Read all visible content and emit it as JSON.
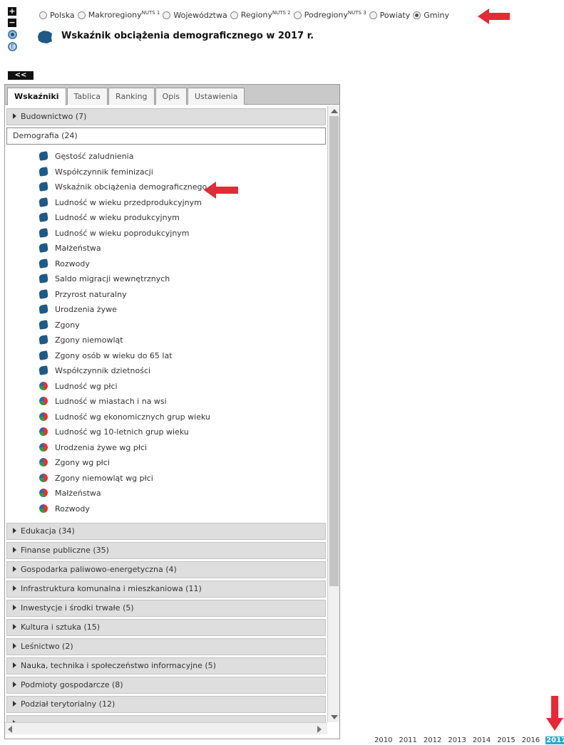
{
  "zoom": {
    "plus": "+",
    "minus": "−",
    "e_label": "E"
  },
  "levels": [
    {
      "label": "Polska",
      "sup": "",
      "selected": false
    },
    {
      "label": "Makroregiony",
      "sup": "NUTS 1",
      "selected": false
    },
    {
      "label": "Województwa",
      "sup": "",
      "selected": false
    },
    {
      "label": "Regiony",
      "sup": "NUTS 2",
      "selected": false
    },
    {
      "label": "Podregiony",
      "sup": "NUTS 3",
      "selected": false
    },
    {
      "label": "Powiaty",
      "sup": "",
      "selected": false
    },
    {
      "label": "Gminy",
      "sup": "",
      "selected": true
    }
  ],
  "page_title": "Wskaźnik obciążenia demograficznego w 2017 r.",
  "collapse_label": "<<",
  "tabs": [
    "Wskaźniki",
    "Tablica",
    "Ranking",
    "Opis",
    "Ustawienia"
  ],
  "active_tab": "Wskaźniki",
  "categories_before": [
    {
      "label": "Budownictwo (7)"
    }
  ],
  "open_category": {
    "label": "Demografia (24)",
    "items": [
      {
        "label": "Gęstość zaludnienia",
        "icon": "map"
      },
      {
        "label": "Współczynnik feminizacji",
        "icon": "map"
      },
      {
        "label": "Wskaźnik obciążenia demograficznego",
        "icon": "map"
      },
      {
        "label": "Ludność w wieku przedprodukcyjnym",
        "icon": "map"
      },
      {
        "label": "Ludność w wieku produkcyjnym",
        "icon": "map"
      },
      {
        "label": "Ludność w wieku poprodukcyjnym",
        "icon": "map"
      },
      {
        "label": "Małżeństwa",
        "icon": "map"
      },
      {
        "label": "Rozwody",
        "icon": "map"
      },
      {
        "label": "Saldo migracji wewnętrznych",
        "icon": "map"
      },
      {
        "label": "Przyrost naturalny",
        "icon": "map"
      },
      {
        "label": "Urodzenia żywe",
        "icon": "map"
      },
      {
        "label": "Zgony",
        "icon": "map"
      },
      {
        "label": "Zgony niemowląt",
        "icon": "map"
      },
      {
        "label": "Zgony osób w wieku do 65 lat",
        "icon": "map"
      },
      {
        "label": "Współczynnik dzietności",
        "icon": "map"
      },
      {
        "label": "Ludność wg płci",
        "icon": "pie"
      },
      {
        "label": "Ludność w miastach i na wsi",
        "icon": "pie"
      },
      {
        "label": "Ludność wg ekonomicznych grup wieku",
        "icon": "pie"
      },
      {
        "label": "Ludność wg 10-letnich grup wieku",
        "icon": "pie"
      },
      {
        "label": "Urodzenia żywe wg płci",
        "icon": "pie"
      },
      {
        "label": "Zgony wg płci",
        "icon": "pie"
      },
      {
        "label": "Zgony niemowląt wg płci",
        "icon": "pie"
      },
      {
        "label": "Małżeństwa",
        "icon": "pie"
      },
      {
        "label": "Rozwody",
        "icon": "pie"
      }
    ]
  },
  "categories_after": [
    {
      "label": "Edukacja (34)"
    },
    {
      "label": "Finanse publiczne (35)"
    },
    {
      "label": "Gospodarka paliwowo-energetyczna (4)"
    },
    {
      "label": "Infrastruktura komunalna i mieszkaniowa (11)"
    },
    {
      "label": "Inwestycje i środki trwałe (5)"
    },
    {
      "label": "Kultura i sztuka (15)"
    },
    {
      "label": "Leśnictwo (2)"
    },
    {
      "label": "Nauka, technika i społeczeństwo informacyjne (5)"
    },
    {
      "label": "Podmioty gospodarcze (8)"
    },
    {
      "label": "Podział terytorialny (12)"
    }
  ],
  "years": [
    "2010",
    "2011",
    "2012",
    "2013",
    "2014",
    "2015",
    "2016",
    "2017"
  ],
  "active_year": "2017",
  "colors": {
    "accent_arrow": "#e32a35",
    "active_year_bg": "#29a6c9",
    "map_icon": "#1e5a85"
  }
}
